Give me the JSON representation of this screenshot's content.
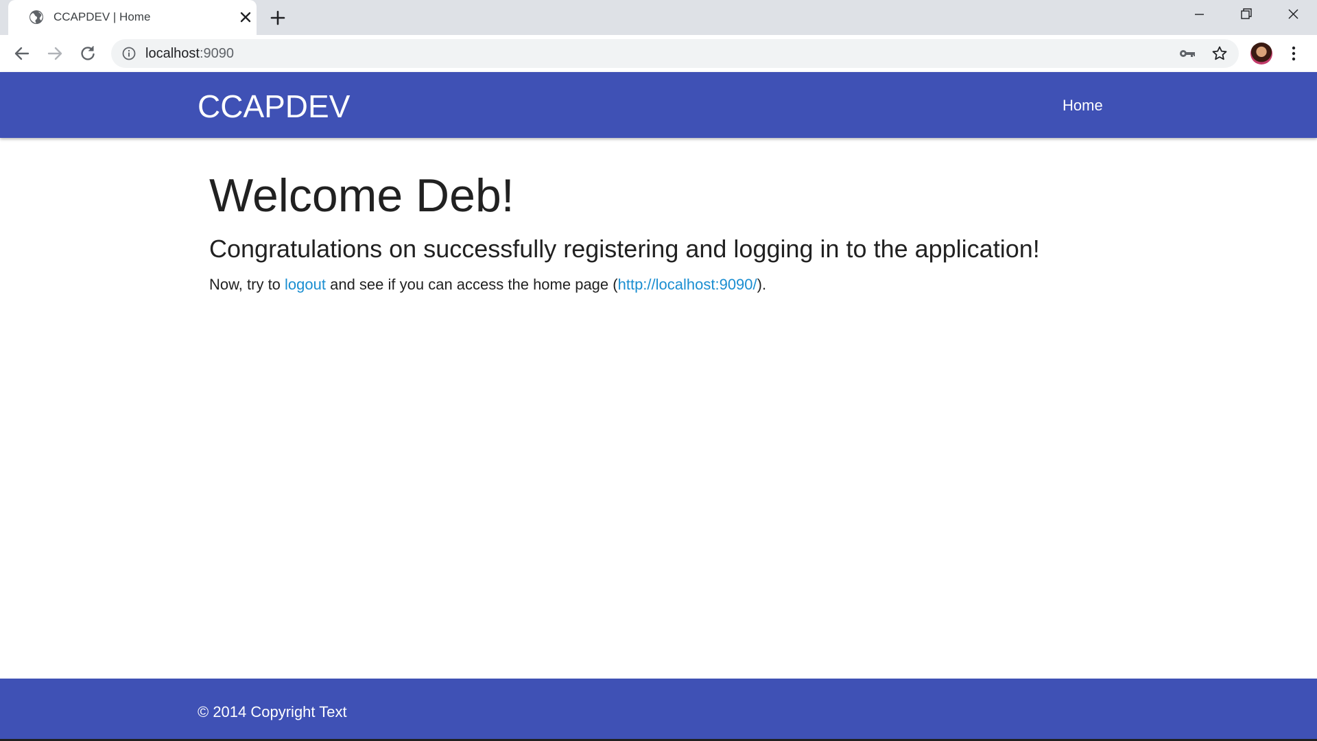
{
  "browser": {
    "tab": {
      "title": "CCAPDEV | Home",
      "favicon": "globe-icon"
    },
    "address_bar": {
      "url_host": "localhost",
      "url_port": ":9090"
    },
    "icons": {
      "back": "arrow-left-icon",
      "forward": "arrow-right-icon",
      "reload": "reload-icon",
      "info": "info-icon",
      "key": "key-icon",
      "bookmark": "star-icon",
      "menu": "kebab-menu-icon"
    }
  },
  "navbar": {
    "brand": "CCAPDEV",
    "links": [
      {
        "label": "Home"
      }
    ],
    "color": "#3f51b5"
  },
  "main": {
    "heading": "Welcome Deb!",
    "subheading": "Congratulations on successfully registering and logging in to the application!",
    "instruction": {
      "prefix": "Now, try to ",
      "logout_link": "logout",
      "middle": " and see if you can access the home page (",
      "home_link": "http://localhost:9090/",
      "suffix": ")."
    },
    "link_color": "#1a8ed1"
  },
  "footer": {
    "text": "© 2014 Copyright Text"
  }
}
